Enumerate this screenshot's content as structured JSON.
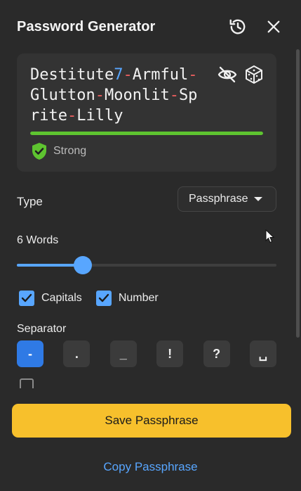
{
  "header": {
    "title": "Password Generator",
    "history_icon": "history-icon",
    "close_icon": "close-icon"
  },
  "password": {
    "segments": [
      {
        "t": "Destitute",
        "k": "w"
      },
      {
        "t": "7",
        "k": "n"
      },
      {
        "t": "-",
        "k": "s"
      },
      {
        "t": "Armful",
        "k": "w"
      },
      {
        "t": "-",
        "k": "s"
      },
      {
        "t": "Glutton",
        "k": "w"
      },
      {
        "t": "-",
        "k": "s"
      },
      {
        "t": "Moonlit",
        "k": "w"
      },
      {
        "t": "-",
        "k": "s"
      },
      {
        "t": "Sprite",
        "k": "w"
      },
      {
        "t": "-",
        "k": "s"
      },
      {
        "t": "Lilly",
        "k": "w"
      }
    ],
    "visibility_icon": "eye-off-icon",
    "regenerate_icon": "dice-icon",
    "strength_label": "Strong",
    "strength_level": 1.0,
    "strength_color": "#5ec430"
  },
  "type": {
    "label": "Type",
    "selected": "Passphrase"
  },
  "words": {
    "label": "6 Words",
    "value": 6,
    "min": 3,
    "max": 20
  },
  "options": [
    {
      "label": "Capitals",
      "checked": true
    },
    {
      "label": "Number",
      "checked": true
    }
  ],
  "separator": {
    "label": "Separator",
    "options": [
      "-",
      ".",
      "_",
      "!",
      "?",
      "␣"
    ],
    "selected_index": 0
  },
  "actions": {
    "save_label": "Save Passphrase",
    "copy_label": "Copy Passphrase"
  },
  "colors": {
    "accent": "#58a6ff",
    "save": "#f7c02c",
    "separator_char": "#ef5f5f",
    "background": "#2a2a2a"
  }
}
